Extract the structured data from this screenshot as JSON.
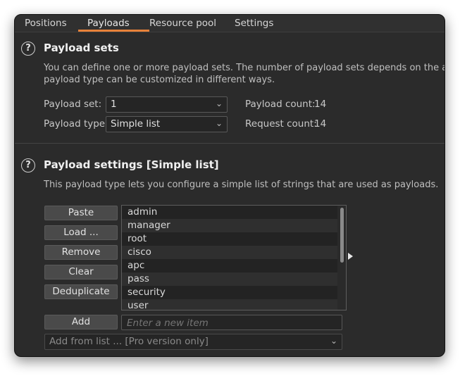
{
  "tabs": [
    {
      "label": "Positions"
    },
    {
      "label": "Payloads"
    },
    {
      "label": "Resource pool"
    },
    {
      "label": "Settings"
    }
  ],
  "active_tab": "Payloads",
  "accent_color": "#e8823a",
  "payload_sets": {
    "help_icon": "?",
    "title": "Payload sets",
    "desc_line1": "You can define one or more payload sets. The number of payload sets depends on the attack t",
    "desc_line2": "payload type can be customized in different ways.",
    "payload_set_label": "Payload set:",
    "payload_set_value": "1",
    "payload_type_label": "Payload type:",
    "payload_type_value": "Simple list",
    "payload_count_label": "Payload count:",
    "payload_count_value": "14",
    "request_count_label": "Request count:",
    "request_count_value": "14"
  },
  "payload_settings": {
    "help_icon": "?",
    "title": "Payload settings [Simple list]",
    "desc": "This payload type lets you configure a simple list of strings that are used as payloads.",
    "buttons": {
      "paste": "Paste",
      "load": "Load ...",
      "remove": "Remove",
      "clear": "Clear",
      "deduplicate": "Deduplicate",
      "add": "Add"
    },
    "items": [
      "admin",
      "manager",
      "root",
      "cisco",
      "apc",
      "pass",
      "security",
      "user"
    ],
    "new_item_placeholder": "Enter a new item",
    "add_from_list": "Add from list ... [Pro version only]"
  }
}
